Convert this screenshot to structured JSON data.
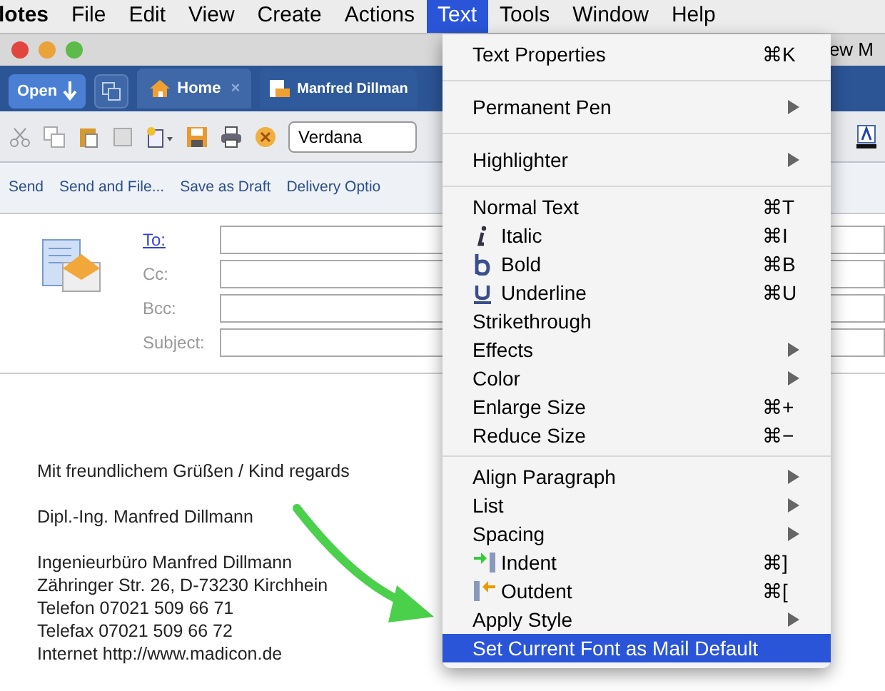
{
  "menu_bar": [
    {
      "label": "lotes",
      "selected": false
    },
    {
      "label": "File",
      "selected": false
    },
    {
      "label": "Edit",
      "selected": false
    },
    {
      "label": "View",
      "selected": false
    },
    {
      "label": "Create",
      "selected": false
    },
    {
      "label": "Actions",
      "selected": false
    },
    {
      "label": "Text",
      "selected": true
    },
    {
      "label": "Tools",
      "selected": false
    },
    {
      "label": "Window",
      "selected": false
    },
    {
      "label": "Help",
      "selected": false
    }
  ],
  "window": {
    "title": "ew M"
  },
  "tabs": [
    {
      "kind": "open",
      "label": "Open"
    },
    {
      "kind": "copy"
    },
    {
      "kind": "home",
      "label": "Home",
      "close": "×",
      "selected": false
    },
    {
      "kind": "mail",
      "label": "Manfred Dillman",
      "selected": true
    }
  ],
  "toolbar": {
    "font": "Verdana"
  },
  "actions": [
    "Send",
    "Send and File...",
    "Save as Draft",
    "Delivery Optio"
  ],
  "header_fields": [
    {
      "label": "To:",
      "link": true
    },
    {
      "label": "Cc:",
      "link": false
    },
    {
      "label": "Bcc:",
      "link": false
    },
    {
      "label": "Subject:",
      "link": false
    }
  ],
  "body": {
    "greeting": "Mit freundlichem Grüßen / Kind regards",
    "name": "Dipl.-Ing. Manfred Dillmann",
    "address": [
      "Ingenieurbüro Manfred Dillmann",
      "Zähringer Str. 26, D-73230 Kirchhein",
      "Telefon 07021 509 66 71",
      "Telefax 07021 509 66 72",
      "Internet http://www.madicon.de"
    ]
  },
  "text_menu": [
    {
      "kind": "large",
      "label": "Text Properties",
      "shortcut": "⌘K",
      "submenu": false,
      "selected": false
    },
    {
      "kind": "separator"
    },
    {
      "kind": "large",
      "label": "Permanent Pen",
      "submenu": true,
      "selected": false
    },
    {
      "kind": "separator"
    },
    {
      "kind": "large",
      "label": "Highlighter",
      "submenu": true,
      "selected": false
    },
    {
      "kind": "separator"
    },
    {
      "kind": "plain",
      "label": "Normal Text",
      "shortcut": "⌘T",
      "submenu": false,
      "selected": false
    },
    {
      "kind": "italic",
      "label": "Italic",
      "shortcut": "⌘I",
      "submenu": false,
      "selected": false
    },
    {
      "kind": "bold",
      "label": "Bold",
      "shortcut": "⌘B",
      "submenu": false,
      "selected": false
    },
    {
      "kind": "underline",
      "label": "Underline",
      "shortcut": "⌘U",
      "submenu": false,
      "selected": false
    },
    {
      "kind": "plain",
      "label": "Strikethrough",
      "submenu": false,
      "selected": false
    },
    {
      "kind": "plain",
      "label": "Effects",
      "submenu": true,
      "selected": false
    },
    {
      "kind": "plain",
      "label": "Color",
      "submenu": true,
      "selected": false
    },
    {
      "kind": "plain",
      "label": "Enlarge Size",
      "shortcut": "⌘+",
      "submenu": false,
      "selected": false
    },
    {
      "kind": "plain",
      "label": "Reduce Size",
      "shortcut": "⌘−",
      "submenu": false,
      "selected": false
    },
    {
      "kind": "separator"
    },
    {
      "kind": "plain",
      "label": "Align Paragraph",
      "submenu": true,
      "selected": false
    },
    {
      "kind": "plain",
      "label": "List",
      "submenu": true,
      "selected": false
    },
    {
      "kind": "plain",
      "label": "Spacing",
      "submenu": true,
      "selected": false
    },
    {
      "kind": "indent",
      "label": "Indent",
      "shortcut": "⌘]",
      "submenu": false,
      "selected": false
    },
    {
      "kind": "outdent",
      "label": "Outdent",
      "shortcut": "⌘[",
      "submenu": false,
      "selected": false
    },
    {
      "kind": "plain",
      "label": "Apply Style",
      "submenu": true,
      "selected": false
    },
    {
      "kind": "plain",
      "label": "Set Current Font as Mail Default",
      "submenu": false,
      "selected": true
    }
  ]
}
